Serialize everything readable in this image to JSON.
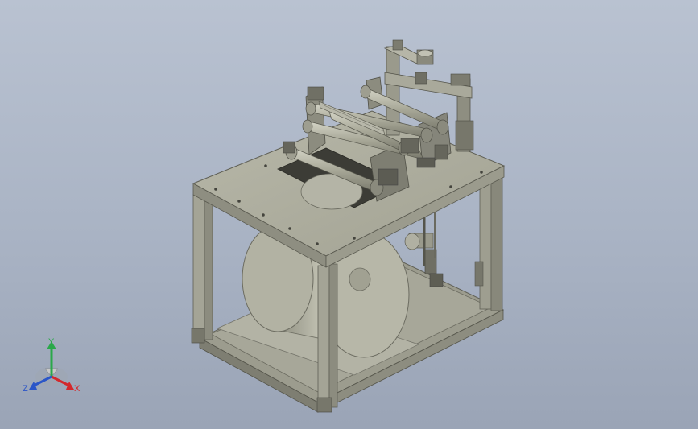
{
  "viewport": {
    "background_top": "#b9c2d1",
    "background_bottom": "#9aa4b6",
    "model_color": "#a9a99a",
    "model_dark": "#6e6e62",
    "model_light": "#c9c9bb"
  },
  "triad": {
    "y_label": "Y",
    "x_label": "X",
    "z_label": "Z",
    "y_color": "#2aa84a",
    "x_color": "#d4282c",
    "z_color": "#2a55c8"
  }
}
